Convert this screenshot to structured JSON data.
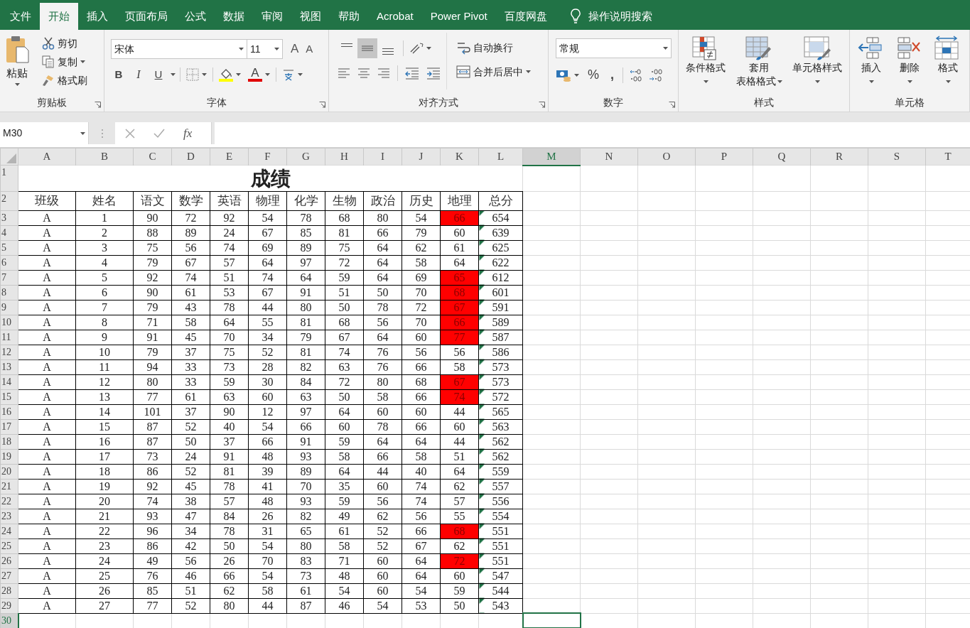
{
  "ribbon_tabs": [
    {
      "label": "文件",
      "selected": false
    },
    {
      "label": "开始",
      "selected": true
    },
    {
      "label": "插入",
      "selected": false
    },
    {
      "label": "页面布局",
      "selected": false
    },
    {
      "label": "公式",
      "selected": false
    },
    {
      "label": "数据",
      "selected": false
    },
    {
      "label": "审阅",
      "selected": false
    },
    {
      "label": "视图",
      "selected": false
    },
    {
      "label": "帮助",
      "selected": false
    },
    {
      "label": "Acrobat",
      "selected": false
    },
    {
      "label": "Power Pivot",
      "selected": false
    },
    {
      "label": "百度网盘",
      "selected": false
    }
  ],
  "tell_me": "操作说明搜索",
  "ribbon": {
    "clipboard": {
      "label": "剪贴板",
      "paste": "粘贴",
      "cut": "剪切",
      "copy": "复制",
      "format_painter": "格式刷"
    },
    "font": {
      "label": "字体",
      "font_name": "宋体",
      "font_size": "11",
      "grow": "A",
      "shrink": "A",
      "bold": "B",
      "italic": "I",
      "underline": "U",
      "font_color": "A"
    },
    "alignment": {
      "label": "对齐方式",
      "wrap_text": "自动换行",
      "merge_center": "合并后居中",
      "middle_selected": true
    },
    "number": {
      "label": "数字",
      "format": "常规",
      "percent": "%",
      "comma": ","
    },
    "styles": {
      "label": "样式",
      "buttons": [
        {
          "lines": [
            "条件格式"
          ],
          "kind": "conditional"
        },
        {
          "lines": [
            "套用",
            "表格格式"
          ],
          "kind": "table"
        },
        {
          "lines": [
            "单元格样式"
          ],
          "kind": "cellstyle"
        }
      ]
    },
    "cells": {
      "label": "单元格",
      "buttons": [
        {
          "lines": [
            "插入"
          ],
          "kind": "insert"
        },
        {
          "lines": [
            "删除"
          ],
          "kind": "delete"
        },
        {
          "lines": [
            "格式"
          ],
          "kind": "format"
        }
      ]
    }
  },
  "formula_bar": {
    "name_box": "M30",
    "fx": "fx"
  },
  "sheet": {
    "columns": [
      {
        "label": "A",
        "selected": false
      },
      {
        "label": "B",
        "selected": false
      },
      {
        "label": "C",
        "selected": false
      },
      {
        "label": "D",
        "selected": false
      },
      {
        "label": "E",
        "selected": false
      },
      {
        "label": "F",
        "selected": false
      },
      {
        "label": "G",
        "selected": false
      },
      {
        "label": "H",
        "selected": false
      },
      {
        "label": "I",
        "selected": false
      },
      {
        "label": "J",
        "selected": false
      },
      {
        "label": "K",
        "selected": false
      },
      {
        "label": "L",
        "selected": false
      },
      {
        "label": "M",
        "selected": true
      },
      {
        "label": "N",
        "selected": false
      },
      {
        "label": "O",
        "selected": false
      },
      {
        "label": "P",
        "selected": false
      },
      {
        "label": "Q",
        "selected": false
      },
      {
        "label": "R",
        "selected": false
      },
      {
        "label": "S",
        "selected": false
      },
      {
        "label": "T",
        "selected": false
      }
    ],
    "title": "成绩",
    "headers": [
      "班级",
      "姓名",
      "语文",
      "数学",
      "英语",
      "物理",
      "化学",
      "生物",
      "政治",
      "历史",
      "地理",
      "总分"
    ],
    "rows": [
      {
        "cells": [
          "A",
          "1",
          "90",
          "72",
          "92",
          "54",
          "78",
          "68",
          "80",
          "54",
          "66",
          "654"
        ],
        "highlight": true,
        "flagged": true
      },
      {
        "cells": [
          "A",
          "2",
          "88",
          "89",
          "24",
          "67",
          "85",
          "81",
          "66",
          "79",
          "60",
          "639"
        ],
        "highlight": false,
        "flagged": true
      },
      {
        "cells": [
          "A",
          "3",
          "75",
          "56",
          "74",
          "69",
          "89",
          "75",
          "64",
          "62",
          "61",
          "625"
        ],
        "highlight": false,
        "flagged": true
      },
      {
        "cells": [
          "A",
          "4",
          "79",
          "67",
          "57",
          "64",
          "97",
          "72",
          "64",
          "58",
          "64",
          "622"
        ],
        "highlight": false,
        "flagged": true
      },
      {
        "cells": [
          "A",
          "5",
          "92",
          "74",
          "51",
          "74",
          "64",
          "59",
          "64",
          "69",
          "65",
          "612"
        ],
        "highlight": true,
        "flagged": true
      },
      {
        "cells": [
          "A",
          "6",
          "90",
          "61",
          "53",
          "67",
          "91",
          "51",
          "50",
          "70",
          "68",
          "601"
        ],
        "highlight": true,
        "flagged": true
      },
      {
        "cells": [
          "A",
          "7",
          "79",
          "43",
          "78",
          "44",
          "80",
          "50",
          "78",
          "72",
          "67",
          "591"
        ],
        "highlight": true,
        "flagged": true
      },
      {
        "cells": [
          "A",
          "8",
          "71",
          "58",
          "64",
          "55",
          "81",
          "68",
          "56",
          "70",
          "66",
          "589"
        ],
        "highlight": true,
        "flagged": true
      },
      {
        "cells": [
          "A",
          "9",
          "91",
          "45",
          "70",
          "34",
          "79",
          "67",
          "64",
          "60",
          "77",
          "587"
        ],
        "highlight": true,
        "flagged": true
      },
      {
        "cells": [
          "A",
          "10",
          "79",
          "37",
          "75",
          "52",
          "81",
          "74",
          "76",
          "56",
          "56",
          "586"
        ],
        "highlight": false,
        "flagged": true
      },
      {
        "cells": [
          "A",
          "11",
          "94",
          "33",
          "73",
          "28",
          "82",
          "63",
          "76",
          "66",
          "58",
          "573"
        ],
        "highlight": false,
        "flagged": true
      },
      {
        "cells": [
          "A",
          "12",
          "80",
          "33",
          "59",
          "30",
          "84",
          "72",
          "80",
          "68",
          "67",
          "573"
        ],
        "highlight": true,
        "flagged": true
      },
      {
        "cells": [
          "A",
          "13",
          "77",
          "61",
          "63",
          "60",
          "63",
          "50",
          "58",
          "66",
          "74",
          "572"
        ],
        "highlight": true,
        "flagged": true
      },
      {
        "cells": [
          "A",
          "14",
          "101",
          "37",
          "90",
          "12",
          "97",
          "64",
          "60",
          "60",
          "44",
          "565"
        ],
        "highlight": false,
        "flagged": true
      },
      {
        "cells": [
          "A",
          "15",
          "87",
          "52",
          "40",
          "54",
          "66",
          "60",
          "78",
          "66",
          "60",
          "563"
        ],
        "highlight": false,
        "flagged": true
      },
      {
        "cells": [
          "A",
          "16",
          "87",
          "50",
          "37",
          "66",
          "91",
          "59",
          "64",
          "64",
          "44",
          "562"
        ],
        "highlight": false,
        "flagged": true
      },
      {
        "cells": [
          "A",
          "17",
          "73",
          "24",
          "91",
          "48",
          "93",
          "58",
          "66",
          "58",
          "51",
          "562"
        ],
        "highlight": false,
        "flagged": true
      },
      {
        "cells": [
          "A",
          "18",
          "86",
          "52",
          "81",
          "39",
          "89",
          "64",
          "44",
          "40",
          "64",
          "559"
        ],
        "highlight": false,
        "flagged": true
      },
      {
        "cells": [
          "A",
          "19",
          "92",
          "45",
          "78",
          "41",
          "70",
          "35",
          "60",
          "74",
          "62",
          "557"
        ],
        "highlight": false,
        "flagged": true
      },
      {
        "cells": [
          "A",
          "20",
          "74",
          "38",
          "57",
          "48",
          "93",
          "59",
          "56",
          "74",
          "57",
          "556"
        ],
        "highlight": false,
        "flagged": true
      },
      {
        "cells": [
          "A",
          "21",
          "93",
          "47",
          "84",
          "26",
          "82",
          "49",
          "62",
          "56",
          "55",
          "554"
        ],
        "highlight": false,
        "flagged": true
      },
      {
        "cells": [
          "A",
          "22",
          "96",
          "34",
          "78",
          "31",
          "65",
          "61",
          "52",
          "66",
          "68",
          "551"
        ],
        "highlight": true,
        "flagged": true
      },
      {
        "cells": [
          "A",
          "23",
          "86",
          "42",
          "50",
          "54",
          "80",
          "58",
          "52",
          "67",
          "62",
          "551"
        ],
        "highlight": false,
        "flagged": true
      },
      {
        "cells": [
          "A",
          "24",
          "49",
          "56",
          "26",
          "70",
          "83",
          "71",
          "60",
          "64",
          "72",
          "551"
        ],
        "highlight": true,
        "flagged": true
      },
      {
        "cells": [
          "A",
          "25",
          "76",
          "46",
          "66",
          "54",
          "73",
          "48",
          "60",
          "64",
          "60",
          "547"
        ],
        "highlight": false,
        "flagged": true
      },
      {
        "cells": [
          "A",
          "26",
          "85",
          "51",
          "62",
          "58",
          "61",
          "54",
          "60",
          "54",
          "59",
          "544"
        ],
        "highlight": false,
        "flagged": true
      },
      {
        "cells": [
          "A",
          "27",
          "77",
          "52",
          "80",
          "44",
          "87",
          "46",
          "54",
          "53",
          "50",
          "543"
        ],
        "highlight": false,
        "flagged": true
      }
    ],
    "row_headers": [
      {
        "label": "1",
        "selected": false
      },
      {
        "label": "2",
        "selected": false
      },
      {
        "label": "3",
        "selected": false
      },
      {
        "label": "4",
        "selected": false
      },
      {
        "label": "5",
        "selected": false
      },
      {
        "label": "6",
        "selected": false
      },
      {
        "label": "7",
        "selected": false
      },
      {
        "label": "8",
        "selected": false
      },
      {
        "label": "9",
        "selected": false
      },
      {
        "label": "10",
        "selected": false
      },
      {
        "label": "11",
        "selected": false
      },
      {
        "label": "12",
        "selected": false
      },
      {
        "label": "13",
        "selected": false
      },
      {
        "label": "14",
        "selected": false
      },
      {
        "label": "15",
        "selected": false
      },
      {
        "label": "16",
        "selected": false
      },
      {
        "label": "17",
        "selected": false
      },
      {
        "label": "18",
        "selected": false
      },
      {
        "label": "19",
        "selected": false
      },
      {
        "label": "20",
        "selected": false
      },
      {
        "label": "21",
        "selected": false
      },
      {
        "label": "22",
        "selected": false
      },
      {
        "label": "23",
        "selected": false
      },
      {
        "label": "24",
        "selected": false
      },
      {
        "label": "25",
        "selected": false
      },
      {
        "label": "26",
        "selected": false
      },
      {
        "label": "27",
        "selected": false
      },
      {
        "label": "28",
        "selected": false
      },
      {
        "label": "29",
        "selected": false
      },
      {
        "label": "30",
        "selected": true
      }
    ]
  }
}
